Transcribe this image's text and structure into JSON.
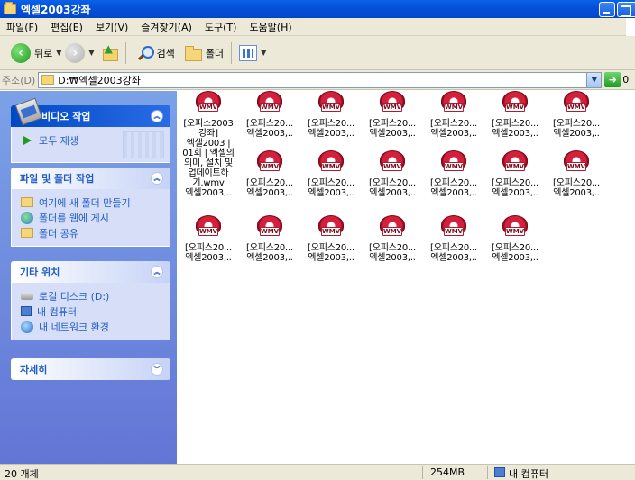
{
  "window": {
    "title": "엑셀2003강좌"
  },
  "menu": [
    "파일(F)",
    "편집(E)",
    "보기(V)",
    "즐겨찾기(A)",
    "도구(T)",
    "도움말(H)"
  ],
  "toolbar": {
    "back_label": "뒤로",
    "search_label": "검색",
    "folders_label": "폴더"
  },
  "address": {
    "label": "주소(D)",
    "path": "D:₩엑셀2003강좌",
    "go_label": "0"
  },
  "left_pane": {
    "video_tasks": {
      "title": "비디오 작업",
      "items": [
        "모두 재생"
      ]
    },
    "file_tasks": {
      "title": "파일 및 폴더 작업",
      "items": [
        "여기에 새 폴더 만들기",
        "폴더를 웹에 게시",
        "폴더 공유"
      ]
    },
    "other_places": {
      "title": "기타 위치",
      "items": [
        "로컬 디스크 (D:)",
        "내 컴퓨터",
        "내 네트워크 환경"
      ]
    },
    "details": {
      "title": "자세히"
    }
  },
  "files": {
    "icon_text": "WMV",
    "first_name": "[오피스2003강좌]\n엑셀2003 | 01회 | 엑셀의\n의미, 설치 및\n업데이트하\n기.wmv\n엑셀2003,..",
    "short_name": "[오피스20...\n엑셀2003,..",
    "count": 20
  },
  "status": {
    "object_count": "20 개체",
    "size": "254MB",
    "location": "내 컴퓨터"
  }
}
